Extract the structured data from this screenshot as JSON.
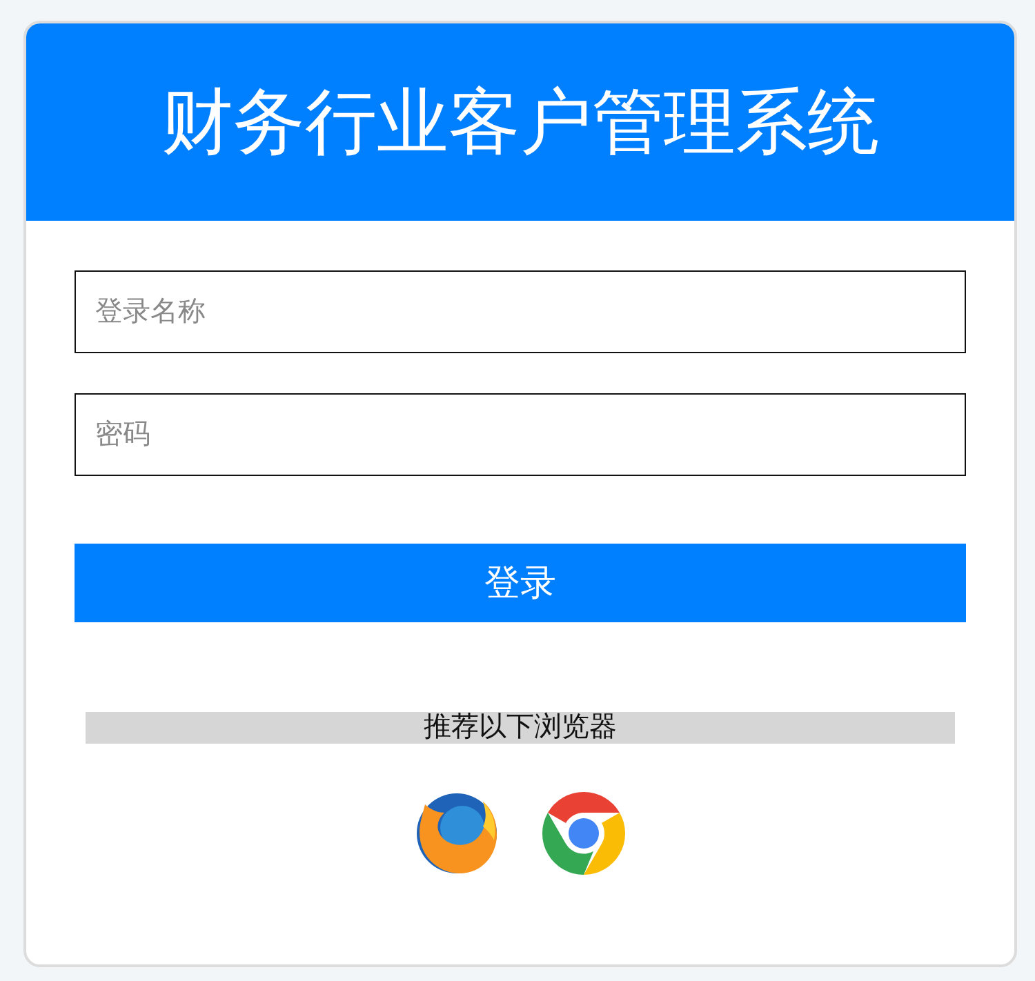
{
  "header": {
    "title": "财务行业客户管理系统"
  },
  "fields": [
    {
      "placeholder": "登录名称"
    },
    {
      "placeholder": "密码"
    }
  ],
  "login_button": {
    "label": "登录"
  },
  "browsers": {
    "caption": "推荐以下浏览器",
    "items": [
      {
        "kind": "firefox"
      },
      {
        "kind": "chrome"
      }
    ]
  }
}
